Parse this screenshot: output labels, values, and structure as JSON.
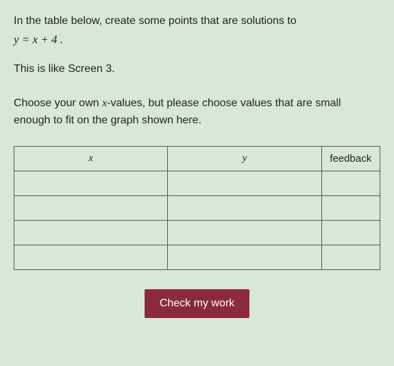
{
  "instruction_line1": "In the table below, create some points that are solutions to",
  "equation": "y = x + 4 .",
  "note": "This is like Screen 3.",
  "instruction2_pre": "Choose your own ",
  "instruction2_var": "x",
  "instruction2_post": "-values, but please choose values that are small enough to fit on the graph shown here.",
  "table": {
    "headers": {
      "x": "x",
      "y": "y",
      "feedback": "feedback"
    },
    "rows": [
      {
        "x": "",
        "y": "",
        "feedback": ""
      },
      {
        "x": "",
        "y": "",
        "feedback": ""
      },
      {
        "x": "",
        "y": "",
        "feedback": ""
      },
      {
        "x": "",
        "y": "",
        "feedback": ""
      }
    ]
  },
  "button_label": "Check my work"
}
